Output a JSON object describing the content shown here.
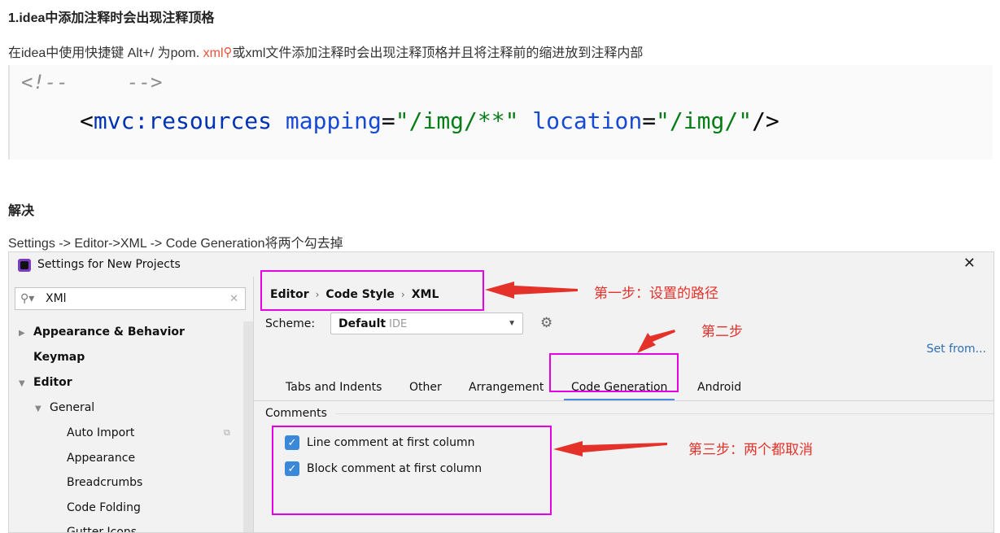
{
  "article": {
    "heading1": "1.idea中添加注释时会出现注释顶格",
    "para1_before": "在idea中使用快捷键 Alt+/ 为pom. ",
    "para1_link": "xml",
    "para1_after": "或xml文件添加注释时会出现注释顶格并且将注释前的缩进放到注释内部",
    "heading2": "解决",
    "para2": "Settings -> Editor->XML -> Code Generation将两个勾去掉"
  },
  "code": {
    "line1": "<!--     -->",
    "line2": {
      "open": "<",
      "tag": "mvc:resources",
      "attr1": "mapping",
      "eq1": "=",
      "val1": "\"/img/**\"",
      "attr2": "location",
      "eq2": "=",
      "val2": "\"/img/\"",
      "close": "/>"
    }
  },
  "dialog": {
    "title": "Settings for New Projects",
    "close": "✕",
    "sidebar": {
      "search_value": "XMl",
      "items": [
        {
          "label": "Appearance & Behavior"
        },
        {
          "label": "Keymap"
        },
        {
          "label": "Editor"
        },
        {
          "label": "General"
        },
        {
          "label": "Auto Import"
        },
        {
          "label": "Appearance"
        },
        {
          "label": "Breadcrumbs"
        },
        {
          "label": "Code Folding"
        },
        {
          "label": "Gutter Icons"
        }
      ]
    },
    "breadcrumb": [
      "Editor",
      "Code Style",
      "XML"
    ],
    "scheme_label": "Scheme:",
    "scheme_value": "Default",
    "scheme_sub": "IDE",
    "set_from": "Set from...",
    "tabs": [
      "Tabs and Indents",
      "Other",
      "Arrangement",
      "Code Generation",
      "Android"
    ],
    "active_tab": "Code Generation",
    "group_label": "Comments",
    "options": [
      {
        "label": "Line comment at first column",
        "checked": true
      },
      {
        "label": "Block comment at first column",
        "checked": true
      }
    ]
  },
  "annotations": {
    "step1": "第一步：设置的路径",
    "step2": "第二步",
    "step3": "第三步：两个都取消",
    "color": "#e4322b",
    "highlight_color": "#e600e6"
  }
}
